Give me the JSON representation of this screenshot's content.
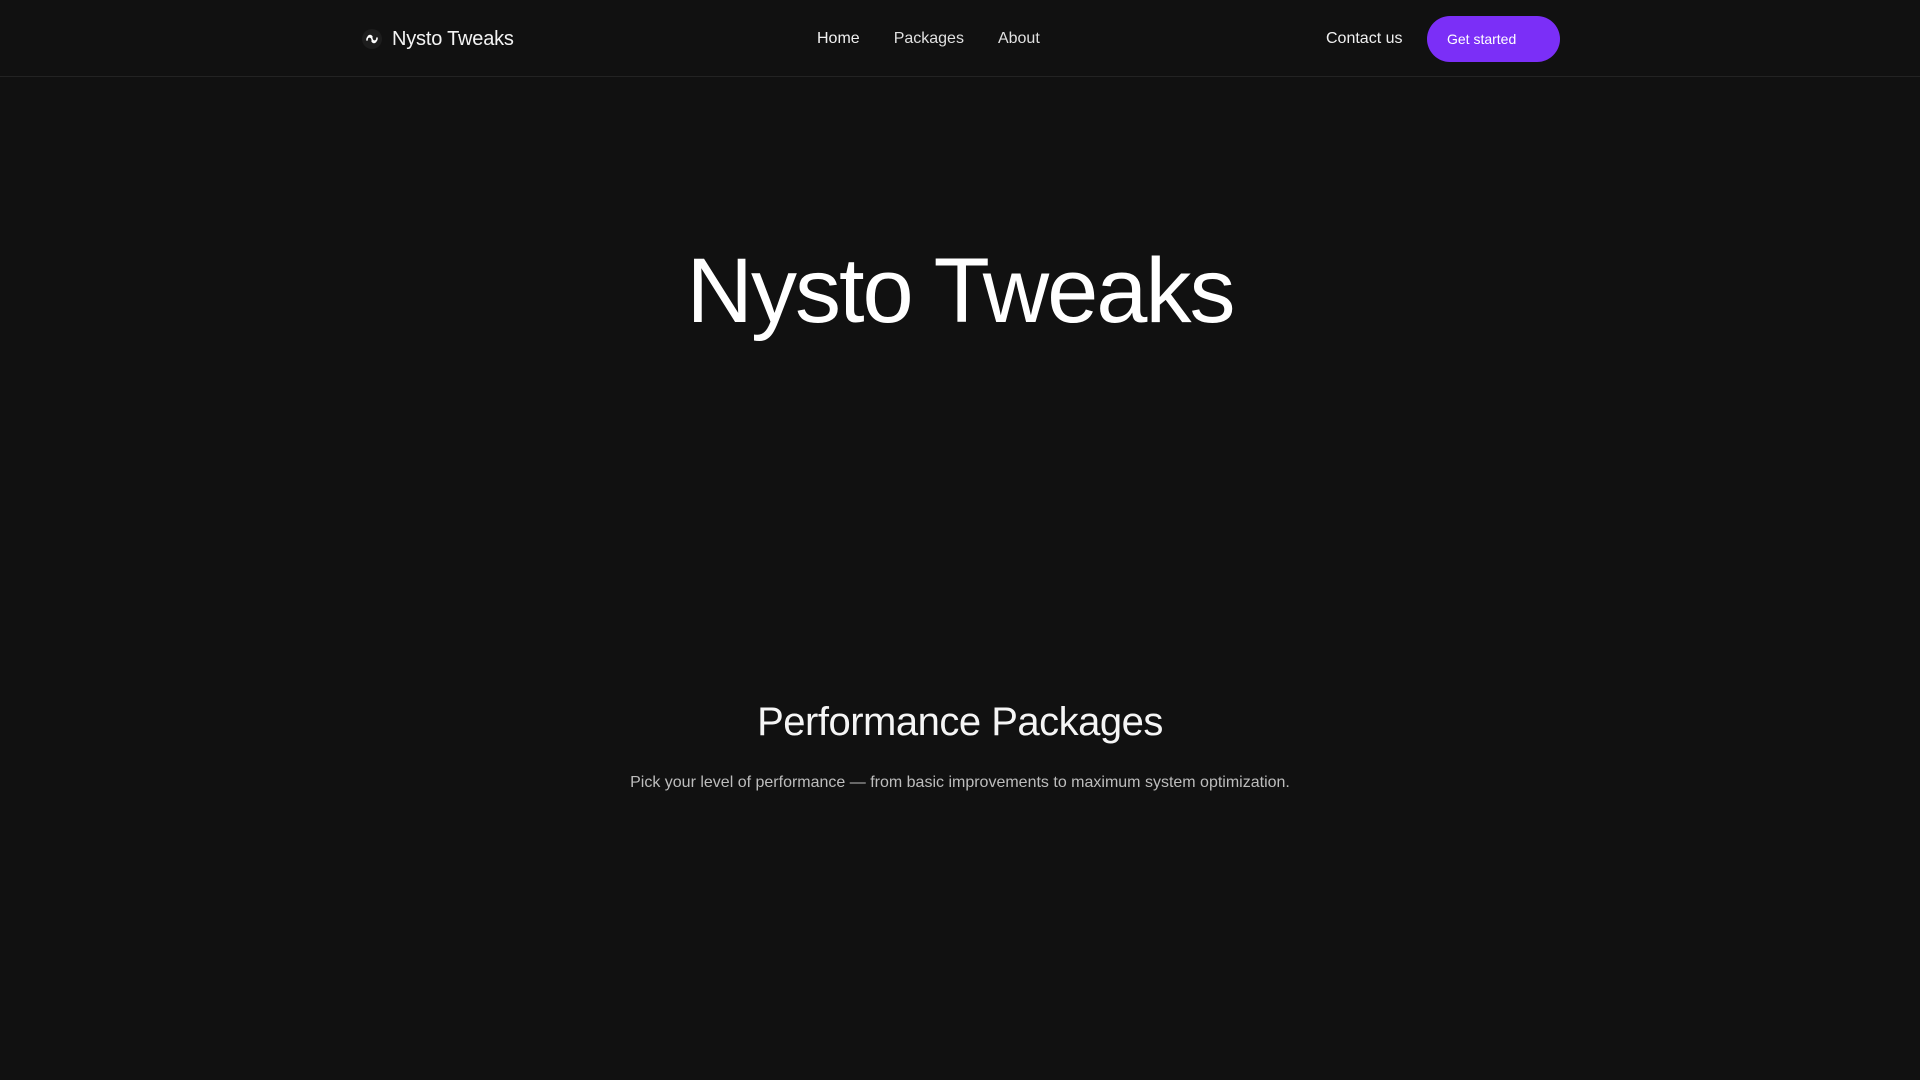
{
  "header": {
    "brand_name": "Nysto Tweaks",
    "brand_icon": "swirl-logo-icon",
    "nav": [
      {
        "label": "Home"
      },
      {
        "label": "Packages"
      },
      {
        "label": "About"
      }
    ],
    "contact_label": "Contact us",
    "cta_label": "Get started"
  },
  "hero": {
    "title": "Nysto Tweaks"
  },
  "packages": {
    "title": "Performance Packages",
    "subtitle": "Pick your level of performance — from basic improvements to maximum system optimization."
  },
  "colors": {
    "background": "#111111",
    "accent": "#7b2ff7",
    "text": "#ffffff",
    "muted_text": "#bdbdbd"
  }
}
